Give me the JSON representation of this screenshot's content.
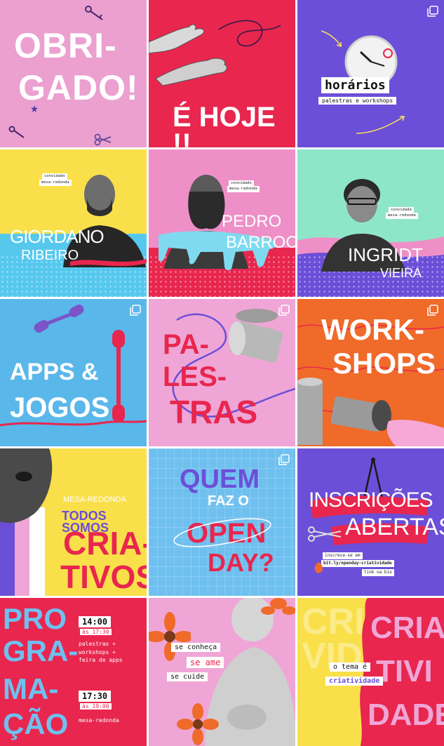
{
  "tiles": {
    "obrigado": {
      "title_line1": "OBRI-",
      "title_line2": "GADO!"
    },
    "hoje": {
      "title": "É HOJE !!"
    },
    "horarios": {
      "title": "horários",
      "subtitle": "palestras e workshops"
    },
    "giordano": {
      "tag_line1": "convidado",
      "tag_line2": "mesa-redonda",
      "first_name": "GIORDANO",
      "last_name": "RIBEIRO"
    },
    "pedro": {
      "tag_line1": "convidado",
      "tag_line2": "mesa-redonda",
      "first_name": "PEDRO",
      "last_name": "BARROCA"
    },
    "ingridt": {
      "tag_line1": "convidada",
      "tag_line2": "mesa-redonda",
      "first_name": "INGRIDT",
      "last_name": "VIEIRA"
    },
    "apps": {
      "line1": "APPS &",
      "line2": "JOGOS"
    },
    "palestras": {
      "line1": "PA-",
      "line2": "LES-",
      "line3": "TRAS"
    },
    "workshops": {
      "line1": "WORK-",
      "line2": "SHOPS"
    },
    "criativos": {
      "kicker": "MESA-REDONDA",
      "line1": "TODOS SOMOS",
      "line2": "CRIA-",
      "line3": "TIVOS"
    },
    "quem": {
      "line1": "QUEM",
      "line2": "FAZ O",
      "line3": "OPEN",
      "line4": "DAY?"
    },
    "inscricoes": {
      "line1": "INSCRIÇÕES",
      "line2": "ABERTAS",
      "note1": "inscreva-se em",
      "link": "bit.ly/openday-criatividade",
      "note2": "link na bio"
    },
    "programacao": {
      "big1": "PRO",
      "big2": "GRA-",
      "big3": "MA-",
      "big4": "ÇÃO",
      "time1": "14:00",
      "until1": "às 17:30",
      "desc1": "palestras +\nworkshops +\nfeira de apps",
      "time2": "17:30",
      "until2": "às 19:00",
      "desc2": "mesa-redonda"
    },
    "seconheca": {
      "line1": "se conheça",
      "line2": "se ame",
      "line3": "se cuide"
    },
    "tema": {
      "bg_text": "CRIA-TIVIDADE",
      "fg1": "CRIA-",
      "fg2": "TIVI",
      "fg3": "DADE",
      "label": "o tema é",
      "value": "criatividade"
    }
  },
  "colors": {
    "pink": "#ea9ccf",
    "red": "#e8264e",
    "purple": "#6b4fd8",
    "yellow": "#f9e04a",
    "blue": "#4aaee8",
    "orange": "#f06a2a",
    "mint": "#8ee6c8"
  }
}
